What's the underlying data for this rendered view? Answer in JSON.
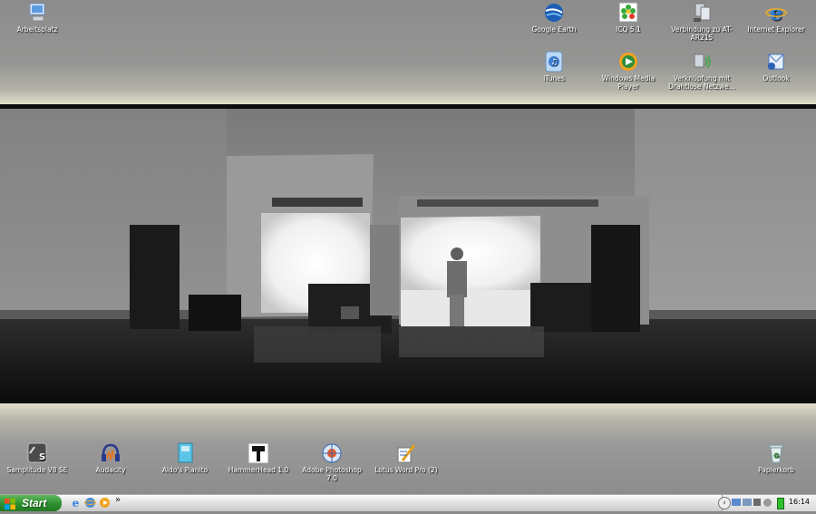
{
  "desktop": {
    "top_icons": [
      {
        "name": "computer-icon",
        "label": "Arbeitsplatz"
      },
      {
        "name": "google-earth-icon",
        "label": "Google Earth"
      },
      {
        "name": "icq-flower-icon",
        "label": "ICQ 5.1"
      },
      {
        "name": "network-connection-icon",
        "label": "Verbindung zu AT-AR215"
      },
      {
        "name": "internet-explorer-icon",
        "label": "Internet Explorer"
      },
      {
        "name": "itunes-icon",
        "label": "iTunes"
      },
      {
        "name": "windows-media-player-icon",
        "label": "Windows Media Player"
      },
      {
        "name": "wireless-connection-icon",
        "label": "Verknüpfung mit Drahtlose Netzwe..."
      },
      {
        "name": "outlook-icon",
        "label": "Outlook"
      }
    ],
    "bottom_icons": [
      {
        "name": "samplitude-icon",
        "label": "Samplitude V8 SE"
      },
      {
        "name": "audacity-icon",
        "label": "Audacity"
      },
      {
        "name": "pianito-icon",
        "label": "Aldo's Pianito"
      },
      {
        "name": "hammerhead-icon",
        "label": "HammerHead 1.0"
      },
      {
        "name": "photoshop-icon",
        "label": "Adobe Photoshop 7.0"
      },
      {
        "name": "lotus-word-pro-icon",
        "label": "Lotus Word Pro (2)"
      },
      {
        "name": "recycle-bin-icon",
        "label": "Papierkorb"
      }
    ]
  },
  "taskbar": {
    "start_label": "Start",
    "quick_launch_more": "»",
    "clock": "16:14"
  }
}
